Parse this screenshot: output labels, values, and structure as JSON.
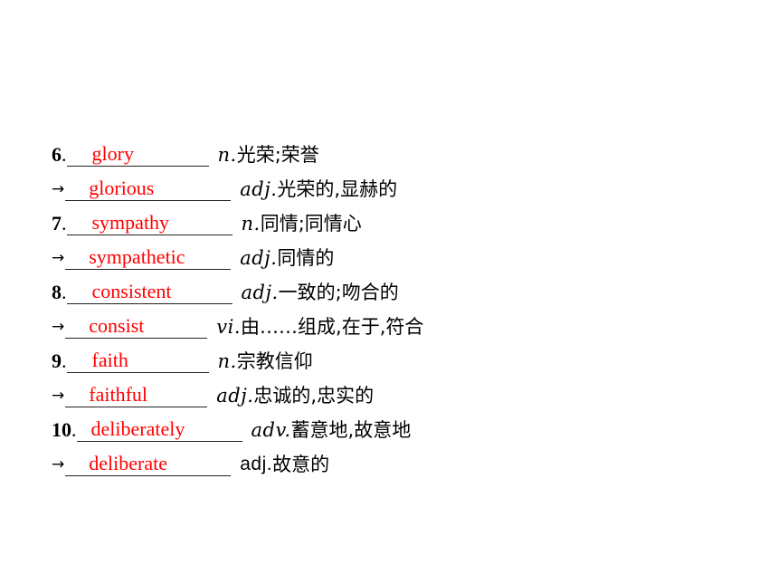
{
  "entries": [
    {
      "prefix": "6",
      "answer": "glory",
      "pos": "n.",
      "definition": "光荣;荣誉"
    },
    {
      "prefix": "→",
      "answer": "glorious",
      "pos": "adj.",
      "definition": "光荣的,显赫的"
    },
    {
      "prefix": "7",
      "answer": "sympathy",
      "pos": "n.",
      "definition": "同情;同情心"
    },
    {
      "prefix": "→",
      "answer": "sympathetic",
      "pos": "adj.",
      "definition": "同情的"
    },
    {
      "prefix": "8",
      "answer": "consistent",
      "pos": "adj.",
      "definition": "一致的;吻合的"
    },
    {
      "prefix": "→",
      "answer": "consist",
      "pos": "vi.",
      "definition": "由……组成,在于,符合"
    },
    {
      "prefix": "9",
      "answer": "faith",
      "pos": "n.",
      "definition": "宗教信仰"
    },
    {
      "prefix": "→",
      "answer": "faithful",
      "pos": "adj.",
      "definition": "忠诚的,忠实的"
    },
    {
      "prefix": "10",
      "answer": "deliberately",
      "pos": "adv.",
      "definition": "蓄意地,故意地"
    },
    {
      "prefix": "→",
      "answer": "deliberate",
      "pos": "adj.",
      "definition": "故意的"
    }
  ],
  "colors": {
    "answer": "#ff0000",
    "text": "#000000"
  }
}
